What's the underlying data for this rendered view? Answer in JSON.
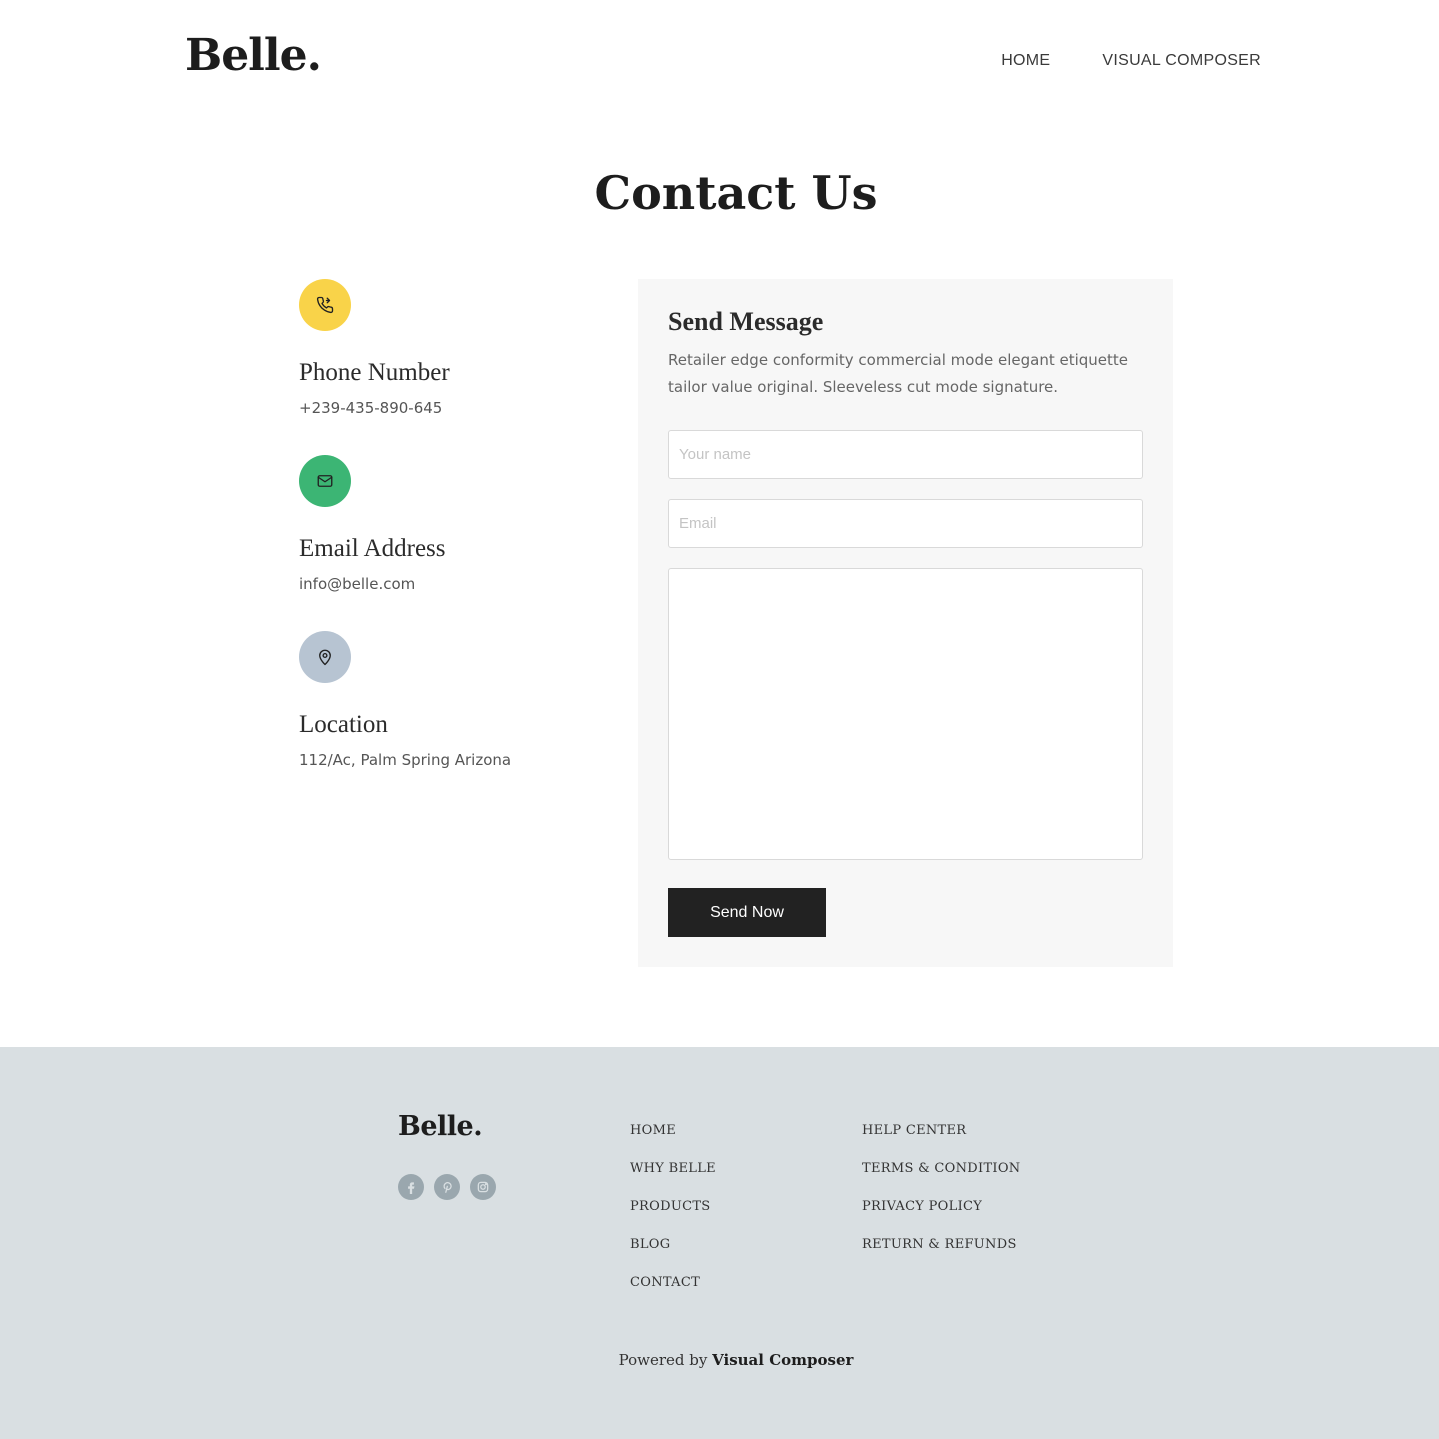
{
  "header": {
    "logo": "Belle.",
    "nav": [
      {
        "label": "HOME"
      },
      {
        "label": "VISUAL COMPOSER"
      }
    ]
  },
  "page": {
    "title": "Contact Us"
  },
  "contact_info": {
    "phone": {
      "heading": "Phone Number",
      "value": "+239-435-890-645",
      "icon": "phone-icon",
      "color": "#f9d349"
    },
    "email": {
      "heading": "Email Address",
      "value": "info@belle.com",
      "icon": "mail-icon",
      "color": "#3cb574"
    },
    "location": {
      "heading": "Location",
      "value": "112/Ac, Palm Spring Arizona",
      "icon": "map-pin-icon",
      "color": "#b7c4d2"
    }
  },
  "form": {
    "title": "Send Message",
    "description": "Retailer edge conformity commercial mode elegant etiquette tailor value original. Sleeveless cut mode signature.",
    "name_placeholder": "Your name",
    "email_placeholder": "Email",
    "message_placeholder": "",
    "submit_label": "Send Now"
  },
  "footer": {
    "logo": "Belle.",
    "social_icons": [
      "facebook-icon",
      "pinterest-icon",
      "instagram-icon"
    ],
    "links_col1": [
      "HOME",
      "WHY BELLE",
      "PRODUCTS",
      "BLOG",
      "CONTACT"
    ],
    "links_col2": [
      "HELP CENTER",
      "TERMS & CONDITION",
      "PRIVACY POLICY",
      "RETURN & REFUNDS"
    ],
    "powered_prefix": "Powered by",
    "powered_brand": "Visual Composer"
  },
  "colors": {
    "footer_bg": "#d9dfe2",
    "panel_bg": "#f7f7f7",
    "button_bg": "#222222"
  }
}
